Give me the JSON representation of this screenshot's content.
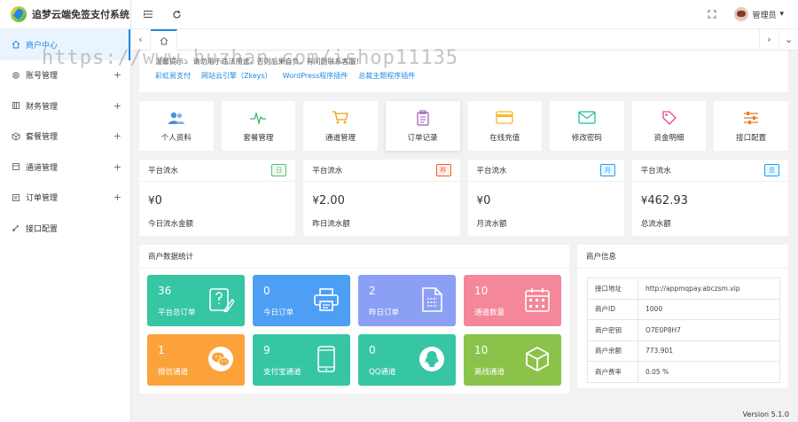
{
  "app": {
    "title": "追梦云端免签支付系统"
  },
  "sidebar": {
    "items": [
      {
        "label": "商户中心",
        "active": true,
        "expandable": false,
        "icon": "home-icon"
      },
      {
        "label": "账号管理",
        "active": false,
        "expandable": true,
        "icon": "gear-icon"
      },
      {
        "label": "财务管理",
        "active": false,
        "expandable": true,
        "icon": "ledger-icon"
      },
      {
        "label": "套餐管理",
        "active": false,
        "expandable": true,
        "icon": "box-icon"
      },
      {
        "label": "通道管理",
        "active": false,
        "expandable": true,
        "icon": "channel-icon"
      },
      {
        "label": "订单管理",
        "active": false,
        "expandable": true,
        "icon": "order-icon"
      },
      {
        "label": "接口配置",
        "active": false,
        "expandable": false,
        "icon": "config-icon"
      }
    ],
    "plus": "+"
  },
  "header": {
    "user": "管理员",
    "caret": "▾"
  },
  "watermark": "https://www.huzhan.com/ishop11135",
  "notice": {
    "line": "温馨提示：    请勿用于违法用途，否则后果自负，有问题联系客服！",
    "links": [
      "彩虹易支付",
      "网站云引擎（Zkeys）",
      "WordPress程序插件",
      "总裁主题程序插件"
    ]
  },
  "quick": [
    {
      "label": "个人资料",
      "icon": "users-icon",
      "color": "#4a90e2"
    },
    {
      "label": "套餐管理",
      "icon": "pulse-icon",
      "color": "#3cb371"
    },
    {
      "label": "通道管理",
      "icon": "cart-icon",
      "color": "#f39c12"
    },
    {
      "label": "订单记录",
      "icon": "clipboard-icon",
      "color": "#9b59b6",
      "highlight": true
    },
    {
      "label": "在线充值",
      "icon": "card-icon",
      "color": "#f5b82e"
    },
    {
      "label": "修改密码",
      "icon": "mail-icon",
      "color": "#1abc9c"
    },
    {
      "label": "资金明细",
      "icon": "tag-icon",
      "color": "#e84393"
    },
    {
      "label": "接口配置",
      "icon": "sliders-icon",
      "color": "#e67e22"
    }
  ],
  "stats": [
    {
      "title": "平台流水",
      "badge": "日",
      "badge_color": "#5fb878",
      "currency": "¥",
      "value": "0",
      "label": "今日流水金额"
    },
    {
      "title": "平台流水",
      "badge": "昨",
      "badge_color": "#ff5722",
      "currency": "¥",
      "value": "2.00",
      "label": "昨日流水额"
    },
    {
      "title": "平台流水",
      "badge": "月",
      "badge_color": "#1e9fff",
      "currency": "¥",
      "value": "0",
      "label": "月流水额"
    },
    {
      "title": "平台流水",
      "badge": "总",
      "badge_color": "#1e9fff",
      "currency": "¥",
      "value": "462.93",
      "label": "总流水额"
    }
  ],
  "merchant_stats": {
    "title": "商户数据统计",
    "tiles": [
      {
        "value": "36",
        "label": "平台总订单",
        "color": "#36c6a3",
        "icon": "order-edit-icon"
      },
      {
        "value": "0",
        "label": "今日订单",
        "color": "#4d9ff5",
        "icon": "printer-icon"
      },
      {
        "value": "2",
        "label": "昨日订单",
        "color": "#8b9ff5",
        "icon": "document-icon"
      },
      {
        "value": "10",
        "label": "通道数量",
        "color": "#f5879a",
        "icon": "calendar-icon"
      },
      {
        "value": "1",
        "label": "微信通道",
        "color": "#fba33a",
        "icon": "wechat-icon"
      },
      {
        "value": "9",
        "label": "支付宝通道",
        "color": "#36c6a3",
        "icon": "tablet-icon"
      },
      {
        "value": "0",
        "label": "QQ通道",
        "color": "#36c6a3",
        "icon": "qq-icon"
      },
      {
        "value": "10",
        "label": "离线通道",
        "color": "#8bc34a",
        "icon": "cube-icon"
      }
    ]
  },
  "merchant_info": {
    "title": "商户信息",
    "rows": [
      {
        "key": "接口地址",
        "value": "http://appmqpay.abczsm.vip"
      },
      {
        "key": "商户ID",
        "value": "1000"
      },
      {
        "key": "商户密钥",
        "value": "O7E0P8H7"
      },
      {
        "key": "商户余额",
        "value": "773.901"
      },
      {
        "key": "商户费率",
        "value": "0.05 %"
      }
    ]
  },
  "version": "Version 5.1.0"
}
